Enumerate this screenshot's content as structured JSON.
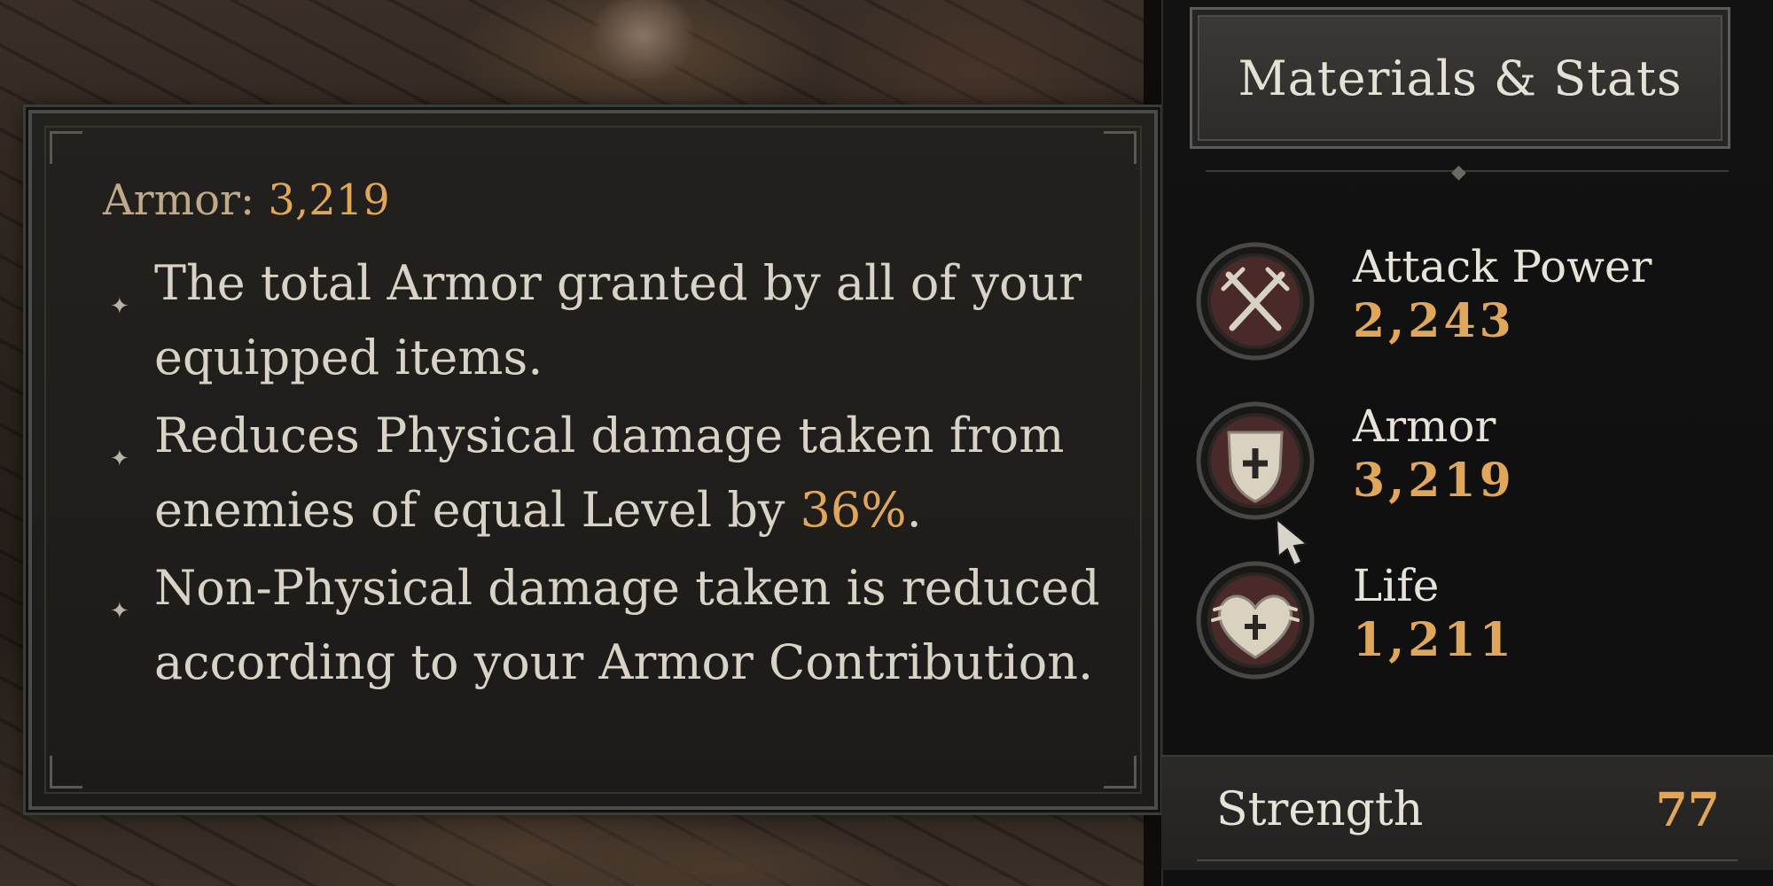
{
  "tooltip": {
    "title_label": "Armor:",
    "title_value": "3,219",
    "bullets": [
      {
        "text": "The total Armor granted by all of your equipped items.",
        "highlight": ""
      },
      {
        "text_before": "Reduces Physical damage taken from enemies of equal Level by",
        "highlight": "36%",
        "text_after": "."
      },
      {
        "text": "Non-Physical damage taken is reduced according to your Armor Contribution."
      }
    ],
    "bullet_glyph": "✦"
  },
  "panel": {
    "title": "Materials & Stats",
    "stats": [
      {
        "label": "Attack Power",
        "value": "2,243",
        "icon": "crossed-swords-icon"
      },
      {
        "label": "Armor",
        "value": "3,219",
        "icon": "shield-icon"
      },
      {
        "label": "Life",
        "value": "1,211",
        "icon": "winged-heart-icon"
      }
    ],
    "attribute": {
      "label": "Strength",
      "value": "77"
    }
  },
  "colors": {
    "accent": "#e0a65a",
    "text": "#d9d3c7",
    "title_muted": "#c2a98a"
  }
}
